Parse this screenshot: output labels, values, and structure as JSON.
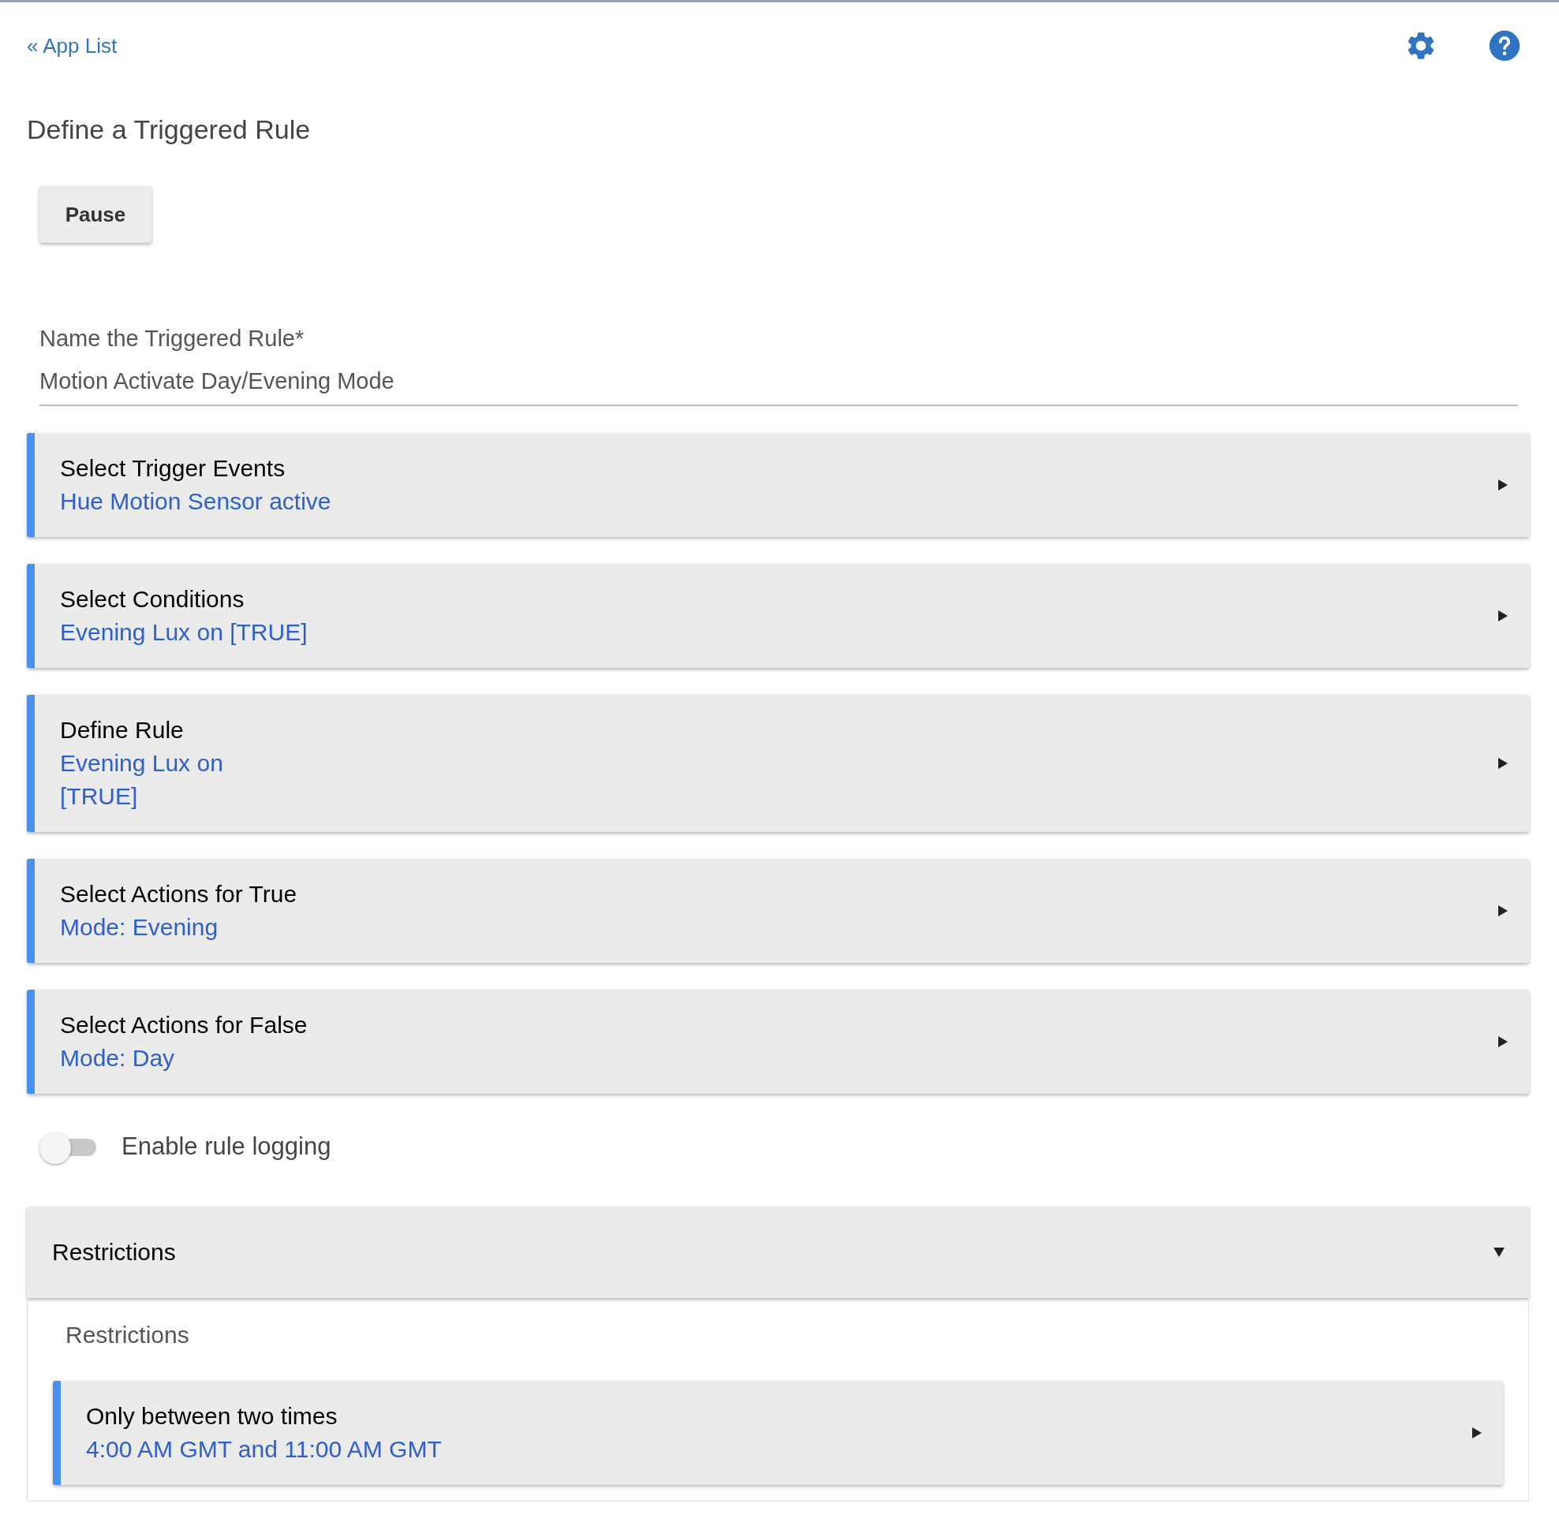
{
  "back_link": "« App List",
  "title": "Define a Triggered Rule",
  "pause_button": "Pause",
  "name_field": {
    "label": "Name the Triggered Rule*",
    "value": "Motion Activate Day/Evening Mode"
  },
  "sections": [
    {
      "title": "Select Trigger Events",
      "summary": "Hue Motion Sensor active"
    },
    {
      "title": "Select Conditions",
      "summary": "Evening Lux on [TRUE]"
    },
    {
      "title": "Define Rule",
      "summary": "Evening Lux on\n[TRUE]"
    },
    {
      "title": "Select Actions for True",
      "summary": "Mode: Evening"
    },
    {
      "title": "Select Actions for False",
      "summary": "Mode: Day"
    }
  ],
  "logging_toggle": {
    "label": "Enable rule logging",
    "on": false
  },
  "restrictions": {
    "title": "Restrictions",
    "expanded": true,
    "heading": "Restrictions",
    "items": [
      {
        "title": "Only between two times",
        "summary": "4:00 AM GMT and 11:00 AM GMT"
      }
    ]
  }
}
